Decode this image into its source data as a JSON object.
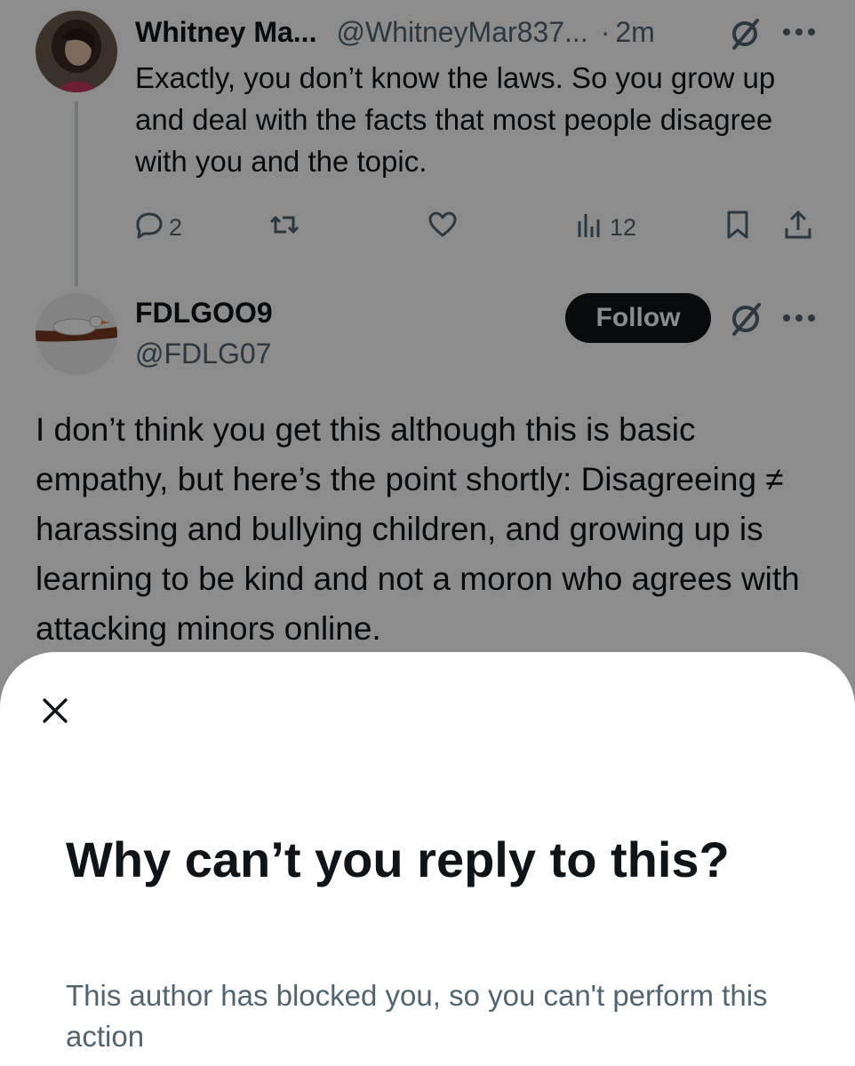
{
  "tweet1": {
    "display_name": "Whitney Ma...",
    "handle": "@WhitneyMar837...",
    "dot": "·",
    "time": "2m",
    "text": "Exactly, you don’t know the laws. So you grow up and deal with the facts that most people disagree with you and the topic.",
    "reply_count": "2",
    "view_count": "12",
    "icons": [
      "reply-icon",
      "retweet-icon",
      "like-icon",
      "views-icon",
      "bookmark-icon",
      "share-icon",
      "grok-icon",
      "more-icon"
    ]
  },
  "tweet2": {
    "display_name": "FDLGOO9",
    "handle": "@FDLG07",
    "follow_label": "Follow",
    "text": "I don’t think you get this although this is basic empathy, but here’s the point shortly: Disagreeing ≠ harassing and bullying children, and growing up is learning to be kind and not a moron who agrees with attacking minors online."
  },
  "sheet": {
    "title": "Why can’t you reply to this?",
    "body": "This author has blocked you, so you can't perform this action"
  },
  "colors": {
    "text_primary": "#0f1419",
    "text_secondary": "#536471",
    "overlay": "rgba(0,0,0,0.45)",
    "sheet_bg": "#ffffff"
  }
}
